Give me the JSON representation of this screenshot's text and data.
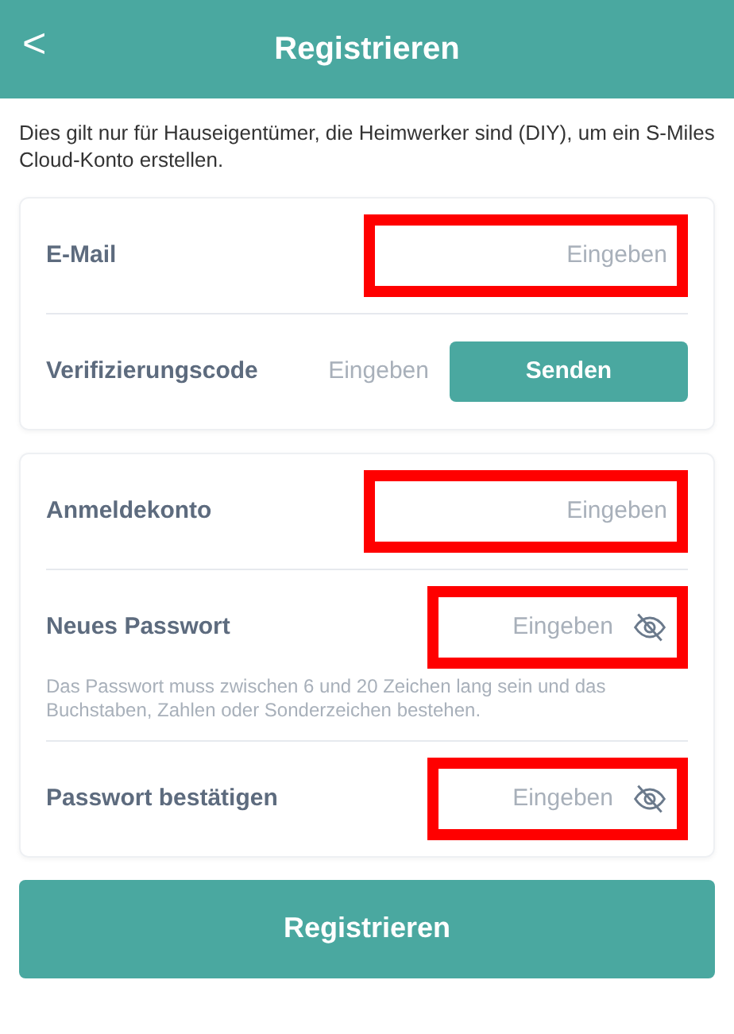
{
  "header": {
    "back": "<",
    "title": "Registrieren"
  },
  "intro": "Dies gilt nur für Hauseigentümer, die Heimwerker sind (DIY), um ein S-Miles Cloud-Konto erstellen.",
  "groups": [
    {
      "fields": [
        {
          "kind": "text",
          "label": "E-Mail",
          "placeholder": "Eingeben",
          "highlighted": true
        },
        {
          "kind": "code",
          "label": "Verifizierungscode",
          "placeholder": "Eingeben",
          "highlighted": false,
          "button": "Senden"
        }
      ]
    },
    {
      "fields": [
        {
          "kind": "text",
          "label": "Anmeldekonto",
          "placeholder": "Eingeben",
          "highlighted": true
        },
        {
          "kind": "password",
          "label": "Neues Passwort",
          "placeholder": "Eingeben",
          "highlighted": true,
          "hint": "Das Passwort muss zwischen 6 und 20 Zeichen lang sein und das Buchstaben, Zahlen oder Sonderzeichen bestehen."
        },
        {
          "kind": "password",
          "label": "Passwort bestätigen",
          "placeholder": "Eingeben",
          "highlighted": true
        }
      ]
    }
  ],
  "submit": "Registrieren"
}
